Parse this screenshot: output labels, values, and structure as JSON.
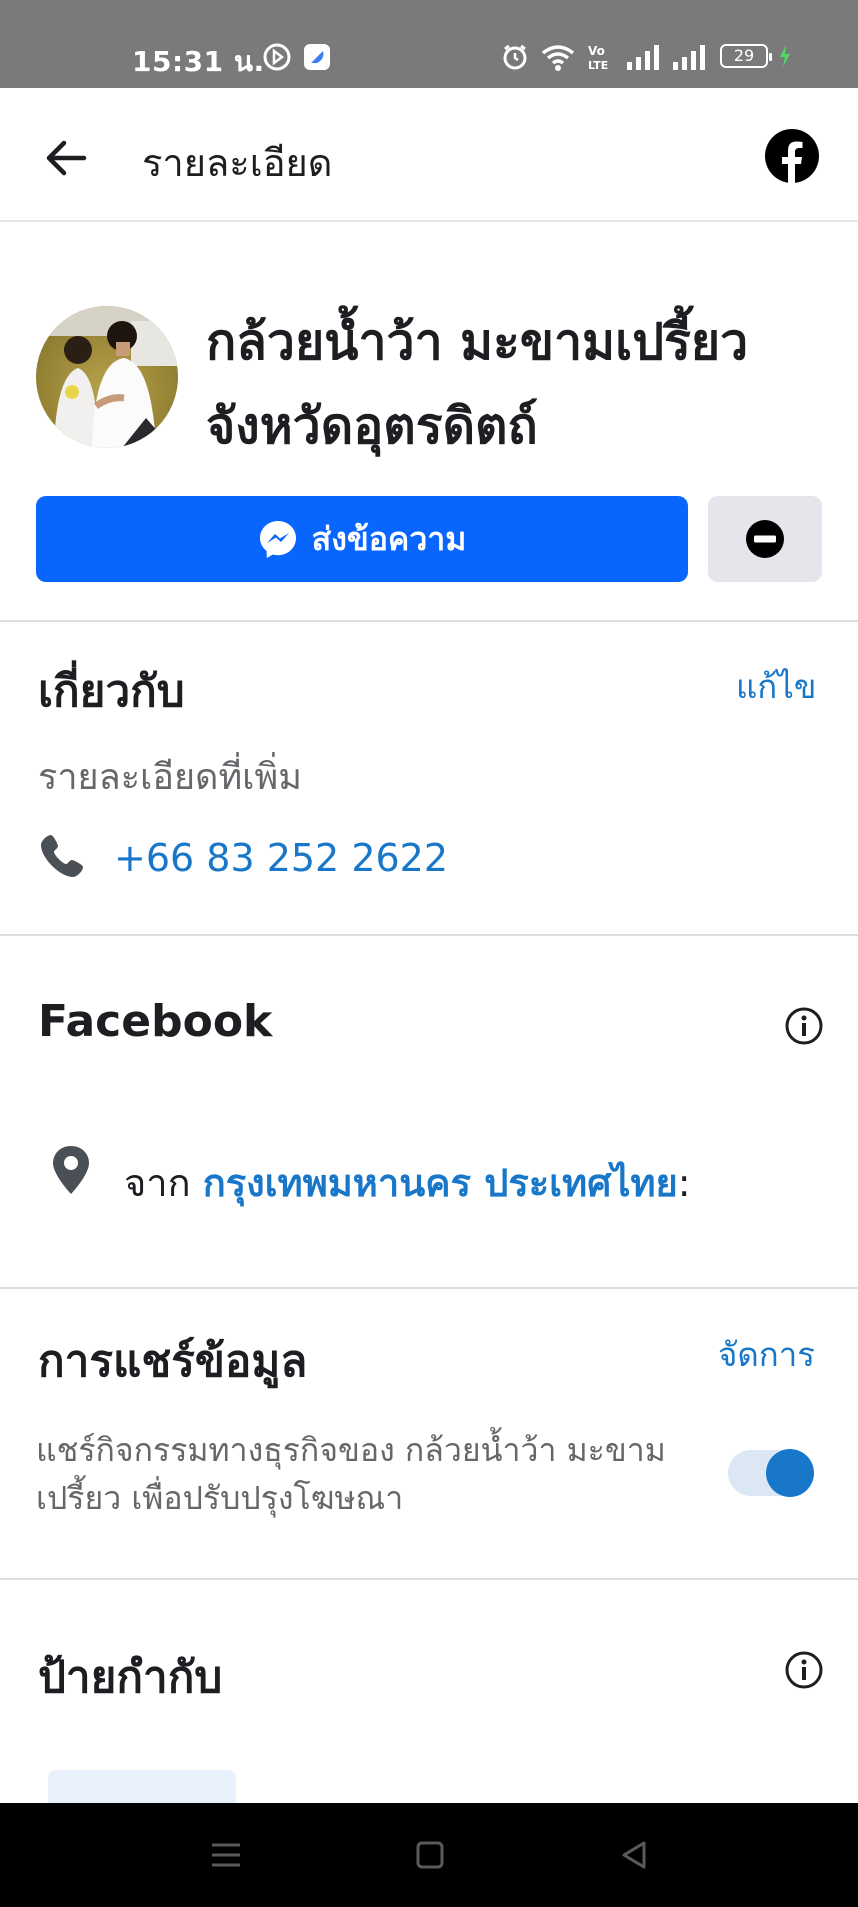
{
  "status_bar": {
    "time": "15:31 น.",
    "battery": "29",
    "network_label": "Vo LTE"
  },
  "header": {
    "title": "รายละเอียด",
    "back_icon": "arrow-left-icon",
    "brand_icon": "facebook-logo-icon"
  },
  "profile": {
    "name": "กล้วยน้ำว้า มะขามเปรี้ยว จังหวัดอุตรดิตถ์",
    "message_button": "ส่งข้อความ",
    "message_icon": "messenger-icon",
    "block_icon": "block-icon"
  },
  "about": {
    "title": "เกี่ยวกับ",
    "edit_label": "แก้ไข",
    "more_details": "รายละเอียดที่เพิ่ม",
    "phone": "+66 83 252 2622"
  },
  "facebook": {
    "title": "Facebook",
    "location_prefix": "จาก ",
    "location": "กรุงเทพมหานคร ประเทศไทย",
    "location_suffix": ":"
  },
  "sharing": {
    "title": "การแชร์ข้อมูล",
    "manage_label": "จัดการ",
    "description": "แชร์กิจกรรมทางธุรกิจของ กล้วยน้ำว้า มะขาม เปรี้ยว เพื่อปรับปรุงโฆษณา",
    "toggle_on": true
  },
  "labels": {
    "title": "ป้ายกำกับ"
  },
  "colors": {
    "accent": "#0866ff",
    "link": "#1877c9",
    "text": "#1c1e21",
    "muted": "#65676b"
  }
}
